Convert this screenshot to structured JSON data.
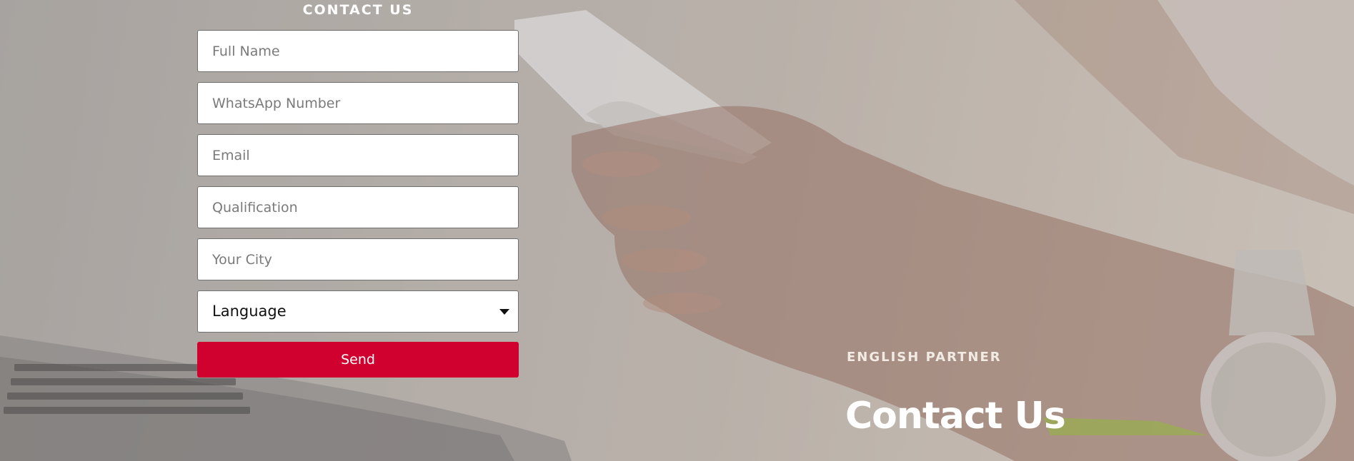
{
  "form": {
    "heading": "CONTACT US",
    "fields": [
      {
        "placeholder": "Full Name"
      },
      {
        "placeholder": "WhatsApp Number"
      },
      {
        "placeholder": "Email"
      },
      {
        "placeholder": "Qualification"
      },
      {
        "placeholder": "Your City"
      }
    ],
    "language_select": {
      "selected": "Language"
    },
    "send_label": "Send"
  },
  "hero": {
    "eyebrow": "ENGLISH PARTNER",
    "title": "Contact Us"
  },
  "colors": {
    "accent": "#d0002f",
    "heading_text": "#ffffff",
    "eyebrow_text": "#f1ebe4"
  },
  "icons": {
    "select_caret": "caret-down-icon"
  }
}
